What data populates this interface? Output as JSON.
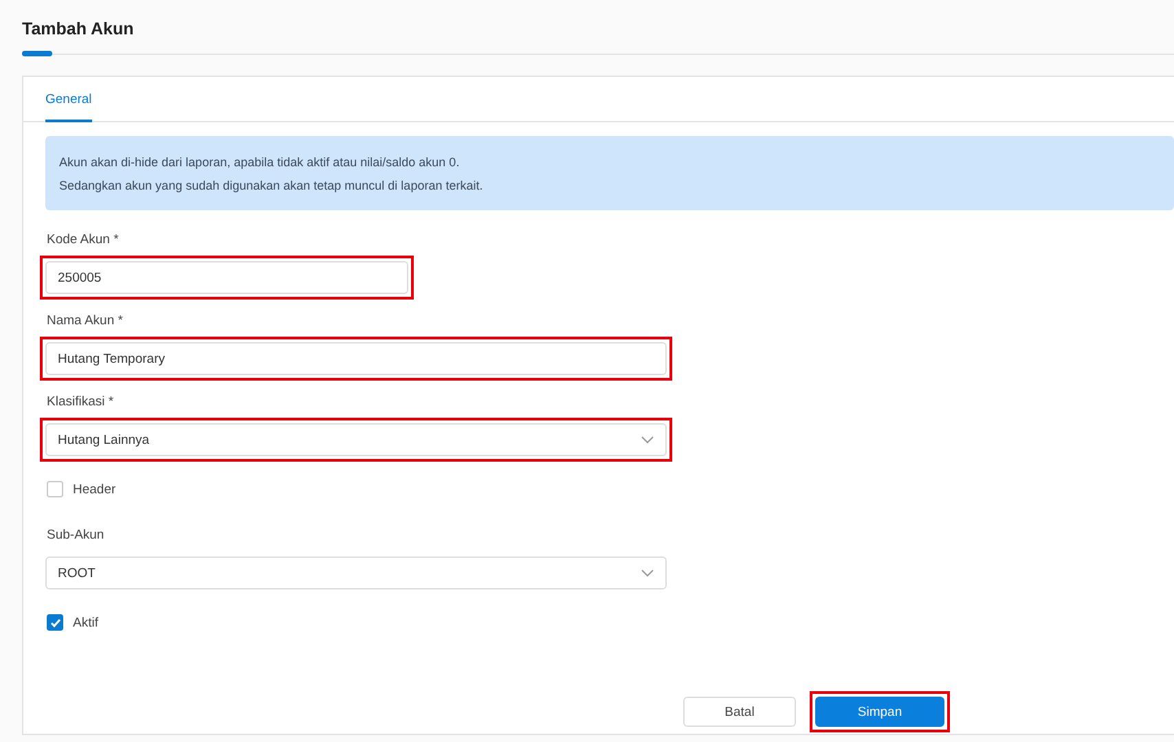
{
  "page": {
    "title": "Tambah Akun"
  },
  "tabs": [
    {
      "label": "General",
      "selected": true
    }
  ],
  "info": [
    "Akun akan di-hide dari laporan, apabila tidak aktif atau nilai/saldo akun 0.",
    "Sedangkan akun yang sudah digunakan akan tetap muncul di laporan terkait."
  ],
  "fields": [
    {
      "kind": "text",
      "label": "Kode Akun *",
      "value": "250005",
      "highlighted": true
    },
    {
      "kind": "text",
      "label": "Nama Akun *",
      "value": "Hutang Temporary",
      "highlighted": true
    },
    {
      "kind": "select",
      "label": "Klasifikasi *",
      "value": "Hutang Lainnya",
      "highlighted": true
    },
    {
      "kind": "checkbox",
      "label": "Header",
      "checked": false
    },
    {
      "kind": "select",
      "label": "Sub-Akun",
      "value": "ROOT",
      "highlighted": false
    },
    {
      "kind": "checkbox",
      "label": "Aktif",
      "checked": true
    }
  ],
  "buttons": [
    {
      "label": "Batal",
      "primary": false,
      "highlighted": false
    },
    {
      "label": "Simpan",
      "primary": true,
      "highlighted": true
    }
  ]
}
